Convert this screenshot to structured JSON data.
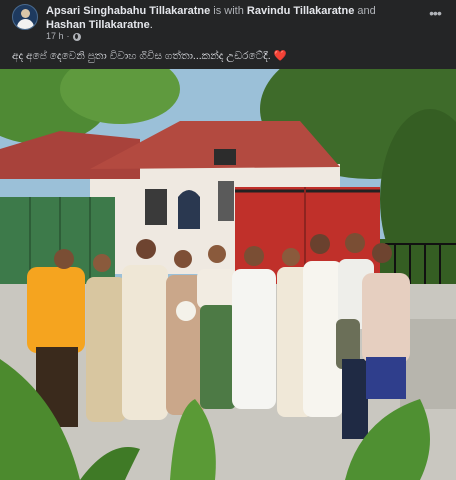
{
  "post": {
    "author": "Apsari Singhabahu Tillakaratne",
    "with_word": "is with",
    "tagged_1": "Ravindu Tillakaratne",
    "and_word": "and",
    "tagged_2": "Hashan Tillakaratne",
    "period": ".",
    "time": "17 h",
    "separator": "·",
    "privacy_icon": "globe-icon",
    "more_icon": "more-options-icon",
    "more_label": "•••",
    "caption": "අද අපේ දෙවෙනි පුතා විවාහ ගිවිස ගත්තා...කන්ද උඩරටේදී.",
    "caption_emoji": "❤️"
  },
  "photo": {
    "subject": "group-photo",
    "colors": {
      "sky": "#9bc0d8",
      "foliage": "#3e6b2a",
      "roof": "#a8423b",
      "wall": "#efe9e1",
      "gate": "#c0302a",
      "fence": "#3d7a4a",
      "ground": "#c9c7c0"
    }
  }
}
